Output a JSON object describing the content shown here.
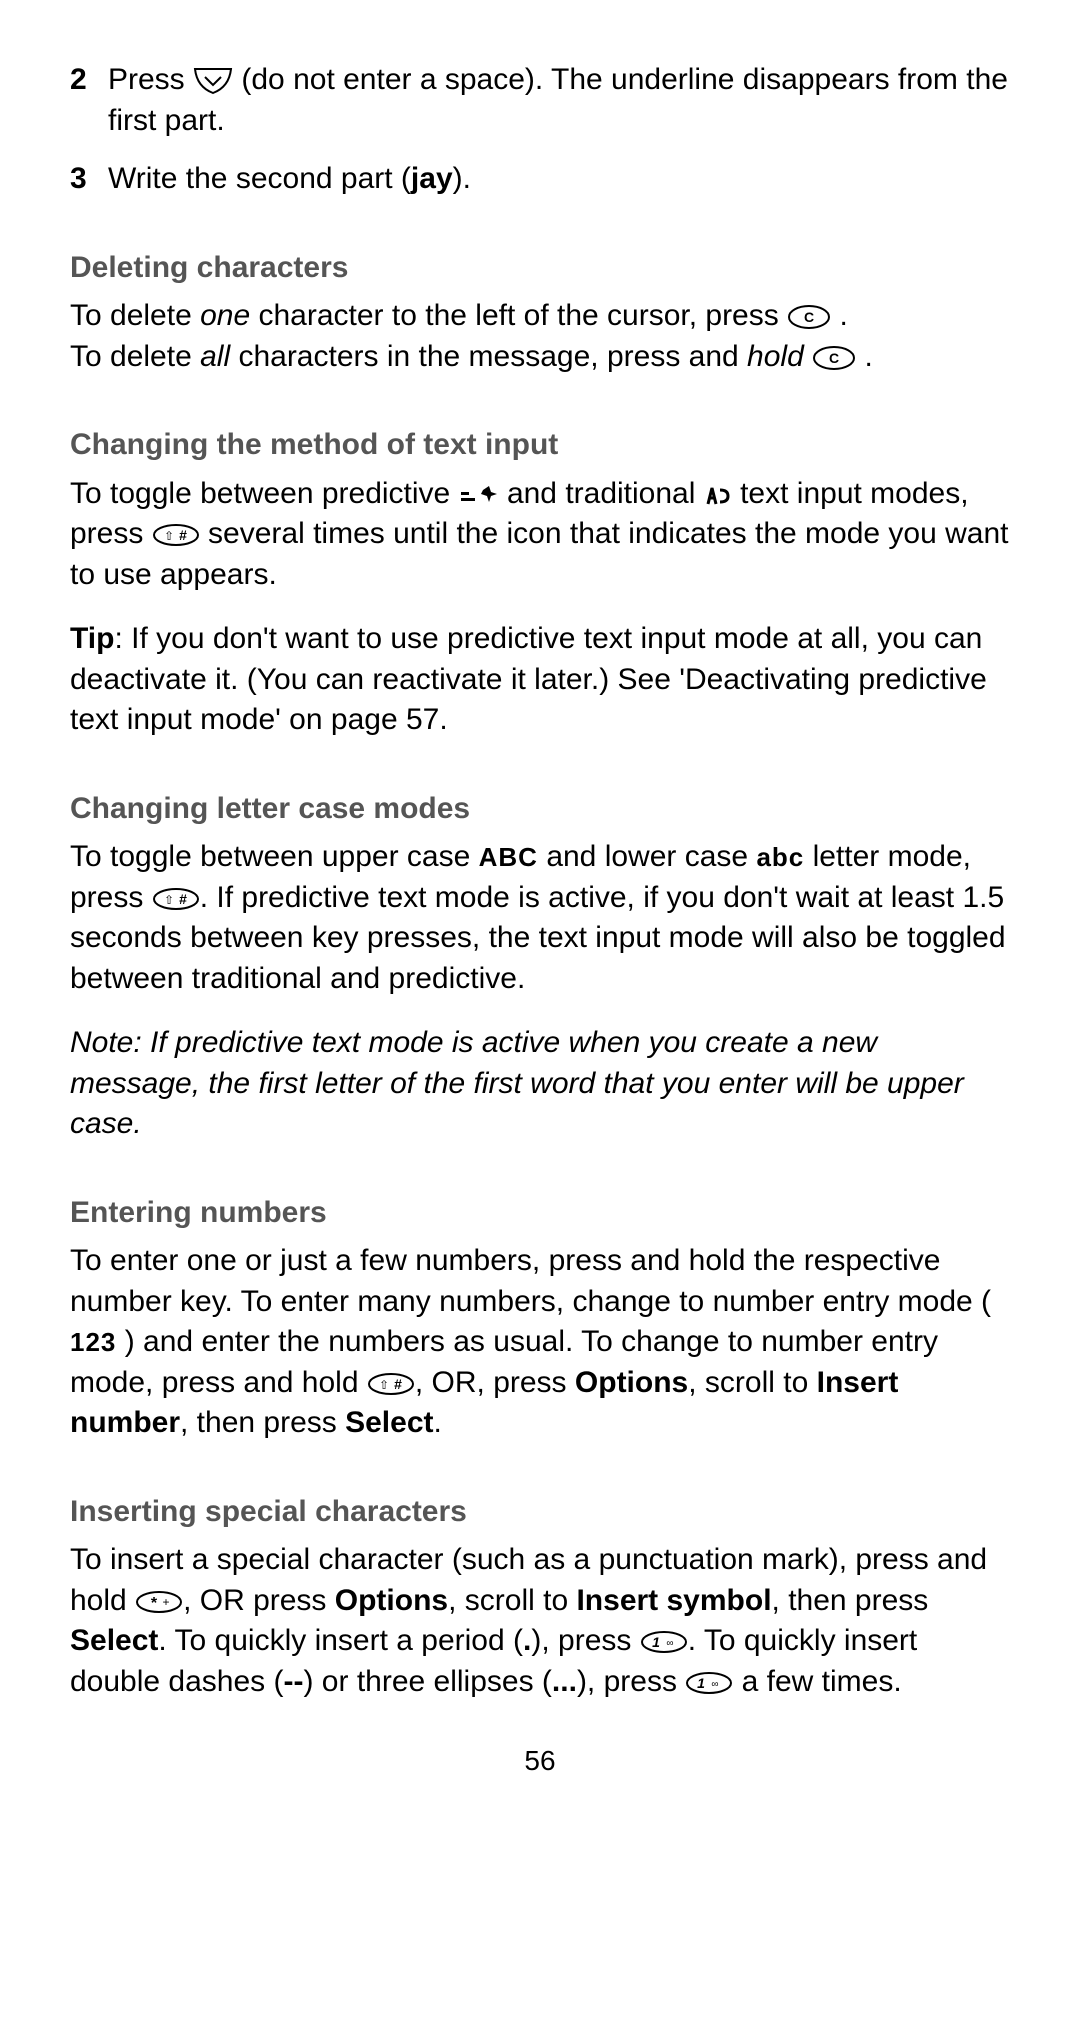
{
  "page_number": "56",
  "steps": {
    "s2_num": "2",
    "s2_a": "Press ",
    "s2_b": " (do not enter a space). The underline disappears from the first part.",
    "s3_num": "3",
    "s3_a": "Write the second part (",
    "s3_bold": "jay",
    "s3_b": ")."
  },
  "del": {
    "title": "Deleting characters",
    "l1a": "To delete ",
    "l1i": "one",
    "l1b": " character to the left of the cursor, press ",
    "l1c": ".",
    "l2a": "To delete ",
    "l2i": "all",
    "l2b": " characters in the message, press and ",
    "l2hi": "hold",
    "l2c": " ",
    "l2d": "."
  },
  "method": {
    "title": "Changing the method of text input",
    "p1a": "To toggle between predictive ",
    "p1b": " and traditional ",
    "p1c": " text input modes, press ",
    "p1d": " several times until the icon that indicates the mode you want to use appears.",
    "tip1": "Tip",
    "tip2": ": If you don't want to use predictive text input mode at all, you can deactivate it. (You can reactivate it later.) See 'Deactivating predictive text input mode' on page 57."
  },
  "case": {
    "title": "Changing letter case modes",
    "a": "To toggle between upper case ",
    "abc_upper": "ABC",
    "b": " and lower case ",
    "abc_lower": "abc",
    "c": " letter mode, press ",
    "d": ". If predictive text mode is active, if you don't wait at least 1.5 seconds between key presses, the text input mode will also be toggled between traditional and predictive.",
    "note": "Note: If predictive text mode is active when you create a new message, the first letter of the first word that you enter will be upper case."
  },
  "nums": {
    "title": "Entering numbers",
    "a": "To enter one or just a few numbers, press and hold the respective number key. To enter many numbers, change to number entry mode ( ",
    "num123": "123",
    "b": " ) and enter the numbers as usual. To change to number entry mode, press and hold ",
    "c": ", OR, press ",
    "opt": "Options",
    "d": ", scroll to ",
    "ins": "Insert number",
    "e": ", then press ",
    "sel": "Select",
    "f": "."
  },
  "special": {
    "title": "Inserting special characters",
    "a": "To insert a special character (such as a punctuation mark), press and hold ",
    "b": ", OR press ",
    "opt": "Options",
    "c": ", scroll to ",
    "ins": "Insert symbol",
    "d": ", then press ",
    "sel": "Select",
    "e": ". To quickly insert a period (",
    "dot": ".",
    "f": "), press ",
    "g": ". To quickly insert double dashes (",
    "dd": "--",
    "h": ") or three ellipses (",
    "el": "...",
    "i": "), press ",
    "j": " a few times."
  }
}
